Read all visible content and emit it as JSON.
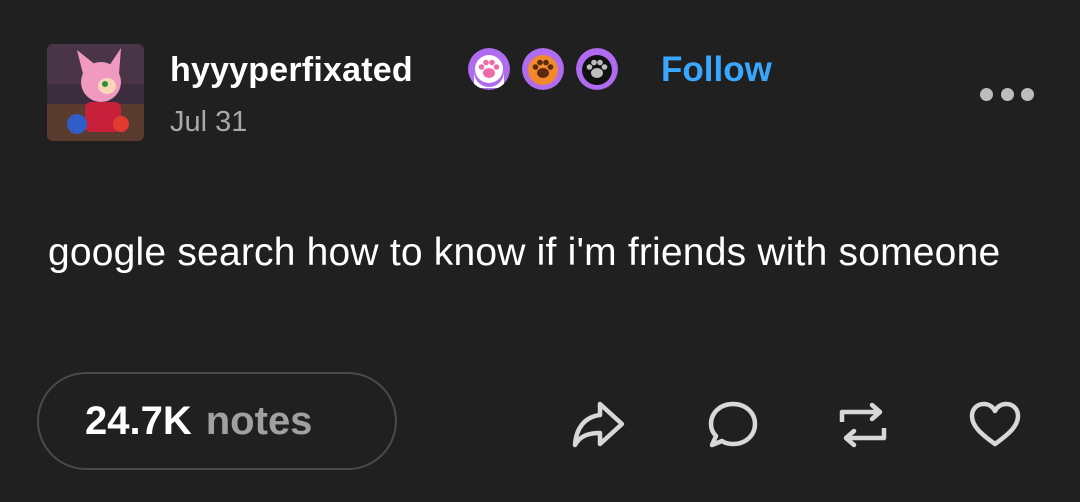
{
  "post": {
    "username": "hyyyperfixated",
    "follow_label": "Follow",
    "date": "Jul 31",
    "body": "google search how to know if i'm friends with someone",
    "notes_count": "24.7K",
    "notes_label": "notes"
  },
  "badges": [
    {
      "name": "paw-badge-pink",
      "ring": "#b06cf0",
      "fill": "#ffffff",
      "paw": "#f06aa8"
    },
    {
      "name": "paw-badge-orange",
      "ring": "#b06cf0",
      "fill": "#f28a2c",
      "paw": "#5a2a10"
    },
    {
      "name": "paw-badge-black",
      "ring": "#b06cf0",
      "fill": "#111111",
      "paw": "#bdbdbd"
    }
  ],
  "colors": {
    "background": "#202020",
    "follow": "#3aa7ff",
    "muted": "#a9a9a9",
    "icon": "#d8d8d8"
  },
  "icons": [
    "share-icon",
    "comment-icon",
    "reblog-icon",
    "heart-icon",
    "more-options-icon"
  ]
}
